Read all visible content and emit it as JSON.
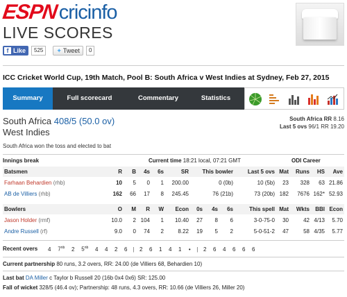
{
  "header": {
    "logo_espn": "ESPN",
    "logo_cricinfo": "cricinfo",
    "title": "LIVE SCORES"
  },
  "social": {
    "fb_label": "Like",
    "fb_count": "525",
    "tweet_label": "Tweet",
    "tweet_count": "0"
  },
  "match": {
    "title": "ICC Cricket World Cup, 19th Match, Pool B: South Africa v West Indies at Sydney, Feb 27, 2015"
  },
  "tabs": [
    "Summary",
    "Full scorecard",
    "Commentary",
    "Statistics"
  ],
  "tab_icons": [
    "pitch-map-icon",
    "scorecard-graph-icon",
    "manhattan-chart-icon",
    "worm-chart-icon",
    "run-rate-chart-icon"
  ],
  "score": {
    "team": "South Africa",
    "runs": "408/5 (50.0 ov)",
    "opponent": "West Indies",
    "rr_label": "South Africa RR",
    "rr_value": "8.16",
    "last5_label": "Last 5 ovs",
    "last5_value": "96/1 RR 19.20",
    "toss": "South Africa won the toss and elected to bat"
  },
  "innings": {
    "label": "Innings break",
    "current_time_label": "Current time",
    "current_time": "18:21 local, 07:21 GMT",
    "odi_career": "ODI Career"
  },
  "batsmen": {
    "headers": [
      "Batsmen",
      "R",
      "B",
      "4s",
      "6s",
      "SR",
      "This bowler",
      "Last 5 ovs",
      "Mat",
      "Runs",
      "HS",
      "Ave"
    ],
    "rows": [
      {
        "name": "Farhaan Behardien",
        "style": "(rhb)",
        "R": "10",
        "B": "5",
        "4s": "0",
        "6s": "1",
        "SR": "200.00",
        "this_bowler": "0 (0b)",
        "last5": "10 (5b)",
        "mat": "23",
        "runs": "328",
        "hs": "63",
        "ave": "21.86"
      },
      {
        "name": "AB de Villiers",
        "style": "(rhb)",
        "R": "162",
        "B": "66",
        "4s": "17",
        "6s": "8",
        "SR": "245.45",
        "this_bowler": "76 (21b)",
        "last5": "73 (20b)",
        "mat": "182",
        "runs": "7676",
        "hs": "162*",
        "ave": "52.93"
      }
    ]
  },
  "bowlers": {
    "headers": [
      "Bowlers",
      "O",
      "M",
      "R",
      "W",
      "Econ",
      "0s",
      "4s",
      "6s",
      "This spell",
      "Mat",
      "Wkts",
      "BBI",
      "Econ"
    ],
    "rows": [
      {
        "name": "Jason Holder",
        "style": "(rmf)",
        "O": "10.0",
        "M": "2",
        "R": "104",
        "W": "1",
        "Econ": "10.40",
        "0s": "27",
        "4s": "8",
        "6s": "6",
        "spell": "3-0-75-0",
        "mat": "30",
        "wkts": "42",
        "bbi": "4/13",
        "econ2": "5.70"
      },
      {
        "name": "Andre Russell",
        "style": "(rf)",
        "O": "9.0",
        "M": "0",
        "R": "74",
        "W": "2",
        "Econ": "8.22",
        "0s": "19",
        "4s": "5",
        "6s": "2",
        "spell": "5-0-51-2",
        "mat": "47",
        "wkts": "58",
        "bbi": "4/35",
        "econ2": "5.77"
      }
    ]
  },
  "recent_overs": {
    "label": "Recent overs",
    "balls": [
      "4",
      "7nb",
      "2",
      "5nb",
      "4",
      "4",
      "2",
      "6",
      "|",
      "2",
      "6",
      "1",
      "4",
      "1",
      "•",
      "|",
      "2",
      "6",
      "4",
      "6",
      "6",
      "6"
    ]
  },
  "partnership": {
    "label": "Current partnership",
    "text": "80 runs, 3.2 overs, RR: 24.00 (de Villiers 68, Behardien 10)"
  },
  "last_bat": {
    "label": "Last bat",
    "player": "DA Miller",
    "text": "c Taylor b Russell 20 (16b 0x4 0x6) SR: 125.00"
  },
  "fall_of_wicket": {
    "label": "Fall of wicket",
    "text": "328/5 (46.4 ov); Partnership: 48 runs, 4.3 overs, RR: 10.66 (de Villiers 26, Miller 20)"
  },
  "colors": {
    "espn_red": "#e20a1b",
    "cricinfo_blue": "#1a5fa5",
    "tab_active": "#1778c2",
    "tab_bar": "#34383c",
    "player_red": "#c0392b"
  }
}
